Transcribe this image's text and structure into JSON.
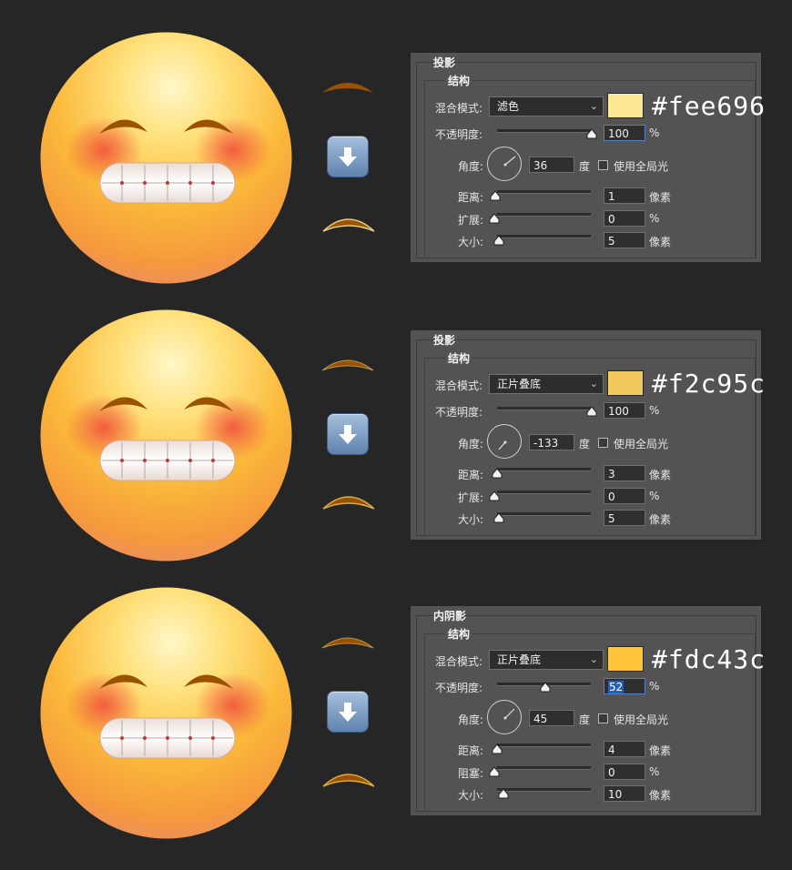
{
  "labels": {
    "structure": "结构",
    "blend_mode": "混合模式:",
    "opacity": "不透明度:",
    "angle": "角度:",
    "degree_unit": "度",
    "use_global_light": "使用全局光",
    "distance": "距离:",
    "size": "大小:",
    "pixel_unit": "像素",
    "percent_unit": "%",
    "choke": "阻塞:",
    "spread": "扩展:"
  },
  "colors": {
    "background": "#262626",
    "panel": "#535353",
    "brow": "#9a5200",
    "button_blue": "#7f9ec4"
  },
  "icons": [
    "down-arrow-icon",
    "chevron-down-icon",
    "checkbox-icon",
    "angle-dial-icon",
    "slider-thumb-icon"
  ],
  "panels": [
    {
      "title": "投影",
      "blend_mode": "滤色",
      "color_hex": "#fee696",
      "opacity": "100",
      "opacity_fraction": 1.0,
      "angle": "36",
      "row5_label": "扩展:",
      "distance": "1",
      "distance_fraction": 0.0,
      "mid_value": "0",
      "mid_fraction": 0.0,
      "size": "5",
      "size_fraction": 0.02
    },
    {
      "title": "投影",
      "blend_mode": "正片叠底",
      "color_hex": "#f2c95c",
      "opacity": "100",
      "opacity_fraction": 1.0,
      "angle": "-133",
      "row5_label": "扩展:",
      "distance": "3",
      "distance_fraction": 0.01,
      "mid_value": "0",
      "mid_fraction": 0.0,
      "size": "5",
      "size_fraction": 0.02
    },
    {
      "title": "内阴影",
      "blend_mode": "正片叠底",
      "color_hex": "#fdc43c",
      "opacity": "52",
      "opacity_fraction": 0.52,
      "angle": "45",
      "row5_label": "阻塞:",
      "distance": "4",
      "distance_fraction": 0.01,
      "mid_value": "0",
      "mid_fraction": 0.0,
      "size": "10",
      "size_fraction": 0.04
    }
  ]
}
